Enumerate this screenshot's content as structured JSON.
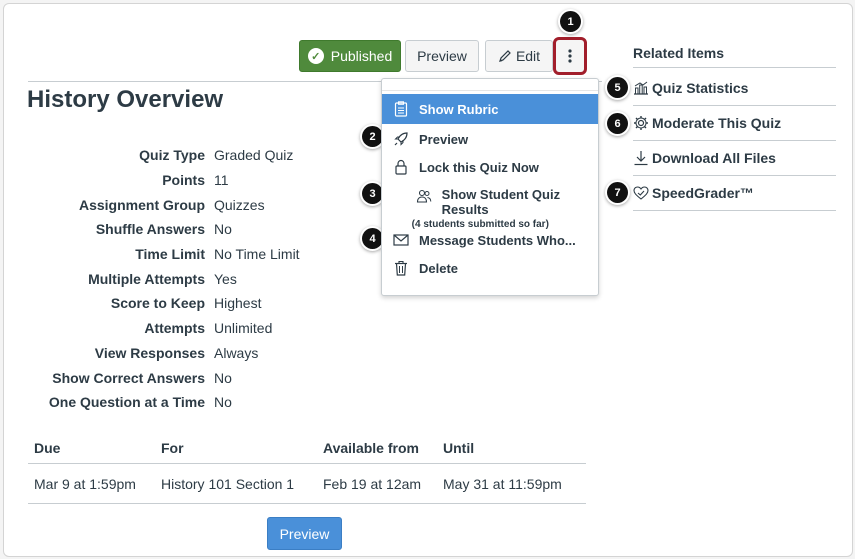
{
  "header": {
    "published_label": "Published",
    "preview_label": "Preview",
    "edit_label": "Edit",
    "more_icon": "kebab-icon"
  },
  "callouts": [
    "1",
    "2",
    "3",
    "4",
    "5",
    "6",
    "7"
  ],
  "page_title": "History Overview",
  "details": [
    {
      "label": "Quiz Type",
      "value": "Graded Quiz"
    },
    {
      "label": "Points",
      "value": "11"
    },
    {
      "label": "Assignment Group",
      "value": "Quizzes"
    },
    {
      "label": "Shuffle Answers",
      "value": "No"
    },
    {
      "label": "Time Limit",
      "value": "No Time Limit"
    },
    {
      "label": "Multiple Attempts",
      "value": "Yes"
    },
    {
      "label": "Score to Keep",
      "value": "Highest"
    },
    {
      "label": "Attempts",
      "value": "Unlimited"
    },
    {
      "label": "View Responses",
      "value": "Always"
    },
    {
      "label": "Show Correct Answers",
      "value": "No"
    },
    {
      "label": "One Question at a Time",
      "value": "No"
    }
  ],
  "dates_table": {
    "headers": [
      "Due",
      "For",
      "Available from",
      "Until"
    ],
    "rows": [
      [
        "Mar 9 at 1:59pm",
        "History 101 Section 1",
        "Feb 19 at 12am",
        "May 31 at 11:59pm"
      ]
    ]
  },
  "bottom_preview_label": "Preview",
  "menu": {
    "items": [
      {
        "label": "Show Rubric",
        "icon": "rubric-icon",
        "active": true
      },
      {
        "label": "Preview",
        "icon": "rocket-icon"
      },
      {
        "label": "Lock this Quiz Now",
        "icon": "lock-icon"
      },
      {
        "label": "Show Student Quiz Results",
        "sublabel": "(4 students submitted so far)",
        "icon": "users-icon"
      },
      {
        "label": "Message Students Who...",
        "icon": "envelope-icon"
      },
      {
        "label": "Delete",
        "icon": "trash-icon"
      }
    ]
  },
  "related": {
    "title": "Related Items",
    "items": [
      {
        "label": "Quiz Statistics",
        "icon": "statistics-icon"
      },
      {
        "label": "Moderate This Quiz",
        "icon": "gear-icon"
      },
      {
        "label": "Download All Files",
        "icon": "download-icon"
      },
      {
        "label": "SpeedGrader™",
        "icon": "speedgrader-icon"
      }
    ]
  },
  "colors": {
    "published_green": "#4f8a3c",
    "active_blue": "#4a90d9",
    "callout_highlight": "#a11e2b"
  }
}
